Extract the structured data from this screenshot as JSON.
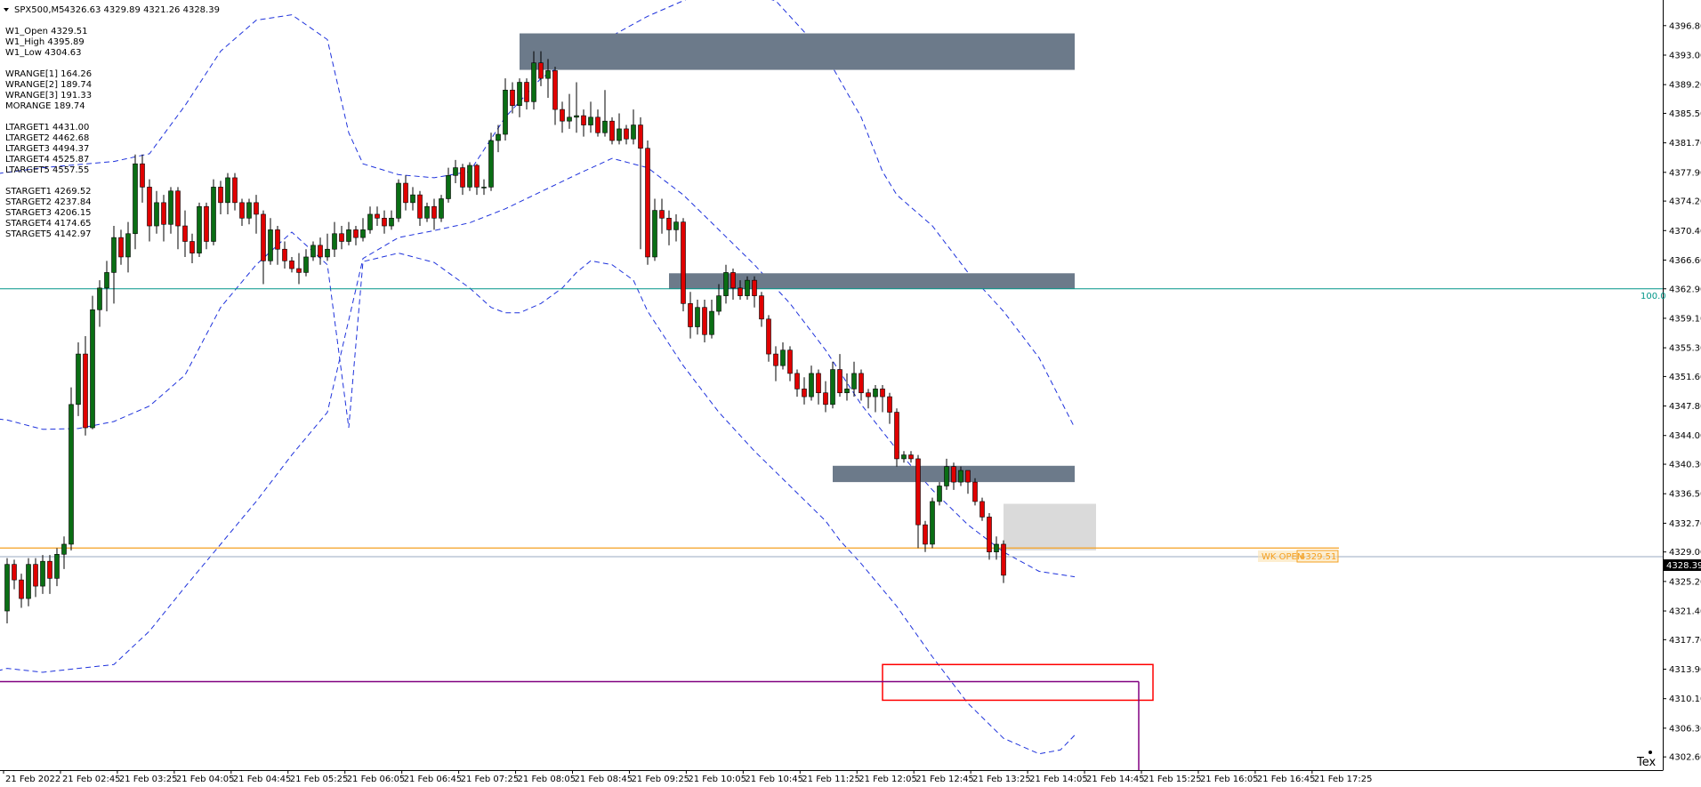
{
  "header": {
    "symbol_timeframe": "SPX500,M5",
    "ohlc": "4326.63 4329.89 4321.26 4328.39"
  },
  "info_panel": [
    "W1_Open 4329.51",
    "W1_High 4395.89",
    "W1_Low 4304.63",
    "",
    "WRANGE[1] 164.26",
    "WRANGE[2] 189.74",
    "WRANGE[3] 191.33",
    "MORANGE 189.74",
    "",
    "LTARGET1 4431.00",
    "LTARGET2 4462.68",
    "LTARGET3 4494.37",
    "LTARGET4 4525.87",
    "LTARGET5 4557.55",
    "",
    "STARGET1 4269.52",
    "STARGET2 4237.84",
    "STARGET3 4206.15",
    "STARGET4 4174.65",
    "STARGET5 4142.97"
  ],
  "colors": {
    "bull": "#0a6e14",
    "bear": "#e00000",
    "wick": "#000000",
    "band": "#1e32dc",
    "zone": "#6c7a8a",
    "teal_line": "#009688",
    "orange_line": "#f5a020",
    "purple_line": "#800080",
    "red_box": "#ff0000",
    "grey_box": "#d3d3d3"
  },
  "labels": {
    "fib_100": "100.0",
    "wk_open": "WK OPEN",
    "wk_open_price": "4329.51",
    "current_price": "4328.39",
    "corner": "Tex"
  },
  "chart_data": {
    "type": "candlestick",
    "symbol": "SPX500",
    "timeframe": "M5",
    "ylim": [
      4300.9,
      4400.1
    ],
    "grid": false,
    "price_ticks": [
      "4396.80",
      "4393.00",
      "4389.20",
      "4385.50",
      "4381.70",
      "4377.90",
      "4374.20",
      "4370.40",
      "4366.60",
      "4362.90",
      "4359.10",
      "4355.30",
      "4351.60",
      "4347.80",
      "4344.00",
      "4340.30",
      "4336.50",
      "4332.70",
      "4329.00",
      "4325.20",
      "4321.40",
      "4317.70",
      "4313.90",
      "4310.10",
      "4306.30",
      "4302.60"
    ],
    "time_labels": [
      "21 Feb 2022",
      "21 Feb 02:45",
      "21 Feb 03:25",
      "21 Feb 04:05",
      "21 Feb 04:45",
      "21 Feb 05:25",
      "21 Feb 06:05",
      "21 Feb 06:45",
      "21 Feb 07:25",
      "21 Feb 08:05",
      "21 Feb 08:45",
      "21 Feb 09:25",
      "21 Feb 10:05",
      "21 Feb 10:45",
      "21 Feb 11:25",
      "21 Feb 12:05",
      "21 Feb 12:45",
      "21 Feb 13:25",
      "21 Feb 14:05",
      "21 Feb 14:45",
      "21 Feb 15:25",
      "21 Feb 16:05",
      "21 Feb 16:45",
      "21 Feb 17:25"
    ],
    "horizontal_levels": {
      "fib_100": 4362.9,
      "weekly_open": 4329.51,
      "current": 4328.39,
      "purple": 4312.3
    },
    "supply_zones": [
      {
        "from_bar": 72,
        "to_bar": 150,
        "top": 4395.8,
        "bottom": 4391.1
      },
      {
        "from_bar": 93,
        "to_bar": 150,
        "top": 4364.9,
        "bottom": 4362.9
      },
      {
        "from_bar": 116,
        "to_bar": 150,
        "top": 4340.1,
        "bottom": 4338.0
      }
    ],
    "demand_box": {
      "from_bar": 123,
      "to_bar": 161,
      "top": 4314.5,
      "bottom": 4309.9
    },
    "range_box": {
      "from_bar": 140,
      "to_bar": 153,
      "top": 4335.2,
      "bottom": 4329.2
    },
    "upper_band": [
      [
        -5,
        4377.3
      ],
      [
        5,
        4378.5
      ],
      [
        15,
        4379.3
      ],
      [
        20,
        4380.3
      ],
      [
        25,
        4386.5
      ],
      [
        30,
        4393.5
      ],
      [
        35,
        4397.5
      ],
      [
        40,
        4398.2
      ],
      [
        45,
        4395
      ],
      [
        48,
        4383
      ],
      [
        50,
        4379
      ],
      [
        55,
        4377.6
      ],
      [
        60,
        4377.2
      ],
      [
        65,
        4378
      ],
      [
        70,
        4385
      ],
      [
        75,
        4390
      ],
      [
        80,
        4393
      ],
      [
        85,
        4395.5
      ],
      [
        90,
        4398
      ],
      [
        100,
        4402
      ],
      [
        108,
        4400
      ],
      [
        115,
        4393
      ],
      [
        120,
        4385
      ],
      [
        123,
        4378
      ],
      [
        125,
        4375
      ],
      [
        130,
        4371
      ],
      [
        135,
        4365
      ],
      [
        140,
        4360
      ],
      [
        145,
        4354
      ],
      [
        150,
        4345
      ]
    ],
    "middle_band": [
      [
        -5,
        4312.8
      ],
      [
        0,
        4314
      ],
      [
        5,
        4313.5
      ],
      [
        10,
        4314
      ],
      [
        15,
        4314.5
      ],
      [
        20,
        4318.8
      ],
      [
        25,
        4324.5
      ],
      [
        30,
        4330
      ],
      [
        35,
        4335.5
      ],
      [
        40,
        4341.5
      ],
      [
        45,
        4347
      ],
      [
        50,
        4366.8
      ],
      [
        55,
        4369.5
      ],
      [
        60,
        4370.4
      ],
      [
        65,
        4371.4
      ],
      [
        70,
        4373.2
      ],
      [
        75,
        4375.4
      ],
      [
        80,
        4377.6
      ],
      [
        85,
        4379.7
      ],
      [
        90,
        4378.5
      ],
      [
        95,
        4375
      ],
      [
        100,
        4370.5
      ],
      [
        105,
        4366
      ],
      [
        110,
        4361
      ],
      [
        115,
        4355
      ],
      [
        120,
        4348
      ],
      [
        125,
        4342.2
      ],
      [
        130,
        4337
      ],
      [
        135,
        4332.5
      ],
      [
        140,
        4329
      ],
      [
        145,
        4326.5
      ],
      [
        150,
        4325.8
      ]
    ],
    "lower_band": [
      [
        -5,
        4346.5
      ],
      [
        0,
        4346
      ],
      [
        5,
        4344.8
      ],
      [
        10,
        4344.9
      ],
      [
        15,
        4345.8
      ],
      [
        20,
        4347.8
      ],
      [
        25,
        4351.8
      ],
      [
        30,
        4360.5
      ],
      [
        35,
        4366
      ],
      [
        40,
        4370.2
      ],
      [
        45,
        4366
      ],
      [
        48,
        4345
      ],
      [
        50,
        4366.4
      ],
      [
        55,
        4367.5
      ],
      [
        60,
        4366.3
      ],
      [
        65,
        4363
      ],
      [
        68,
        4360.5
      ],
      [
        70,
        4359.8
      ],
      [
        72,
        4359.8
      ],
      [
        75,
        4361
      ],
      [
        78,
        4363
      ],
      [
        80,
        4365
      ],
      [
        82,
        4366.5
      ],
      [
        85,
        4366
      ],
      [
        88,
        4364
      ],
      [
        90,
        4360
      ],
      [
        95,
        4353
      ],
      [
        100,
        4347
      ],
      [
        105,
        4342
      ],
      [
        110,
        4337.5
      ],
      [
        115,
        4333
      ],
      [
        117,
        4330.5
      ],
      [
        120,
        4327.5
      ],
      [
        125,
        4322
      ],
      [
        130,
        4315.5
      ],
      [
        135,
        4309.5
      ],
      [
        140,
        4305
      ],
      [
        145,
        4303
      ],
      [
        148,
        4303.5
      ],
      [
        150,
        4305.4
      ]
    ],
    "candles": [
      [
        4321.4,
        4327.4,
        4319.8,
        4328.2
      ],
      [
        4327.4,
        4325.4,
        4324.2,
        4328.0
      ],
      [
        4325.4,
        4323.0,
        4321.8,
        4326.2
      ],
      [
        4323.0,
        4327.4,
        4322.0,
        4328.2
      ],
      [
        4327.4,
        4324.6,
        4323.2,
        4328.2
      ],
      [
        4324.6,
        4327.8,
        4323.6,
        4328.6
      ],
      [
        4327.8,
        4325.6,
        4323.6,
        4328.6
      ],
      [
        4325.6,
        4328.7,
        4324.6,
        4329.5
      ],
      [
        4328.7,
        4330.0,
        4326.8,
        4331.0
      ],
      [
        4330.0,
        4348.0,
        4329.2,
        4350.2
      ],
      [
        4348.0,
        4354.5,
        4346.5,
        4356.0
      ],
      [
        4354.5,
        4345.0,
        4344.0,
        4356.8
      ],
      [
        4345.0,
        4360.2,
        4344.8,
        4362.0
      ],
      [
        4360.2,
        4363.0,
        4358.0,
        4364.0
      ],
      [
        4363.0,
        4365.0,
        4360.0,
        4366.5
      ],
      [
        4365.0,
        4369.5,
        4361.0,
        4371.0
      ],
      [
        4369.5,
        4367.0,
        4366.0,
        4370.5
      ],
      [
        4367.0,
        4370.0,
        4365.0,
        4371.5
      ],
      [
        4370.0,
        4379.0,
        4368.0,
        4380.2
      ],
      [
        4379.0,
        4376.0,
        4374.0,
        4380.2
      ],
      [
        4376.0,
        4371.0,
        4369.0,
        4377.0
      ],
      [
        4371.0,
        4374.0,
        4370.0,
        4375.5
      ],
      [
        4374.0,
        4371.2,
        4369.0,
        4375.0
      ],
      [
        4371.2,
        4375.5,
        4370.0,
        4376.0
      ],
      [
        4375.5,
        4371.0,
        4368.0,
        4376.0
      ],
      [
        4371.0,
        4369.0,
        4367.0,
        4373.0
      ],
      [
        4369.0,
        4367.5,
        4366.2,
        4370.0
      ],
      [
        4367.5,
        4373.5,
        4367.0,
        4374.0
      ],
      [
        4373.5,
        4369.0,
        4368.0,
        4374.0
      ],
      [
        4369.0,
        4376.0,
        4368.5,
        4377.0
      ],
      [
        4376.0,
        4374.0,
        4372.5,
        4376.8
      ],
      [
        4374.0,
        4377.2,
        4372.5,
        4377.8
      ],
      [
        4377.2,
        4374.0,
        4373.0,
        4377.8
      ],
      [
        4374.0,
        4372.0,
        4371.0,
        4374.5
      ],
      [
        4372.0,
        4374.0,
        4371.2,
        4374.5
      ],
      [
        4374.0,
        4372.5,
        4370.0,
        4375.0
      ],
      [
        4372.5,
        4366.5,
        4363.5,
        4373.0
      ],
      [
        4366.5,
        4370.5,
        4366.0,
        4372.0
      ],
      [
        4370.5,
        4368.0,
        4366.0,
        4371.0
      ],
      [
        4368.0,
        4366.5,
        4365.5,
        4369.0
      ],
      [
        4366.5,
        4365.5,
        4365.0,
        4367.0
      ],
      [
        4365.5,
        4365.0,
        4363.5,
        4367.5
      ],
      [
        4365.0,
        4367.0,
        4364.5,
        4368.0
      ],
      [
        4367.0,
        4368.5,
        4366.5,
        4369.0
      ],
      [
        4368.5,
        4367.0,
        4366.0,
        4369.5
      ],
      [
        4367.0,
        4368.0,
        4366.5,
        4370.0
      ],
      [
        4368.0,
        4370.0,
        4367.0,
        4371.5
      ],
      [
        4370.0,
        4369.0,
        4368.0,
        4371.0
      ],
      [
        4369.0,
        4370.5,
        4368.5,
        4371.5
      ],
      [
        4370.5,
        4369.5,
        4368.5,
        4371.0
      ],
      [
        4369.5,
        4370.5,
        4369.0,
        4372.0
      ],
      [
        4370.5,
        4372.5,
        4370.0,
        4373.5
      ],
      [
        4372.5,
        4372.0,
        4371.0,
        4373.5
      ],
      [
        4372.0,
        4371.0,
        4370.0,
        4373.0
      ],
      [
        4371.0,
        4372.0,
        4370.5,
        4373.0
      ],
      [
        4372.0,
        4376.5,
        4371.5,
        4377.0
      ],
      [
        4376.5,
        4374.0,
        4373.0,
        4377.5
      ],
      [
        4374.0,
        4375.0,
        4373.0,
        4376.0
      ],
      [
        4375.0,
        4372.0,
        4371.0,
        4375.5
      ],
      [
        4372.0,
        4373.5,
        4371.5,
        4374.0
      ],
      [
        4373.5,
        4372.0,
        4370.5,
        4374.5
      ],
      [
        4372.0,
        4374.5,
        4371.5,
        4375.0
      ],
      [
        4374.5,
        4377.5,
        4374.0,
        4378.5
      ],
      [
        4377.5,
        4378.5,
        4376.5,
        4379.5
      ],
      [
        4378.5,
        4376.0,
        4375.0,
        4379.0
      ],
      [
        4376.0,
        4378.8,
        4375.5,
        4379.2
      ],
      [
        4378.8,
        4376.0,
        4375.0,
        4379.0
      ],
      [
        4376.0,
        4376.0,
        4375.0,
        4377.0
      ],
      [
        4376.0,
        4382.0,
        4375.5,
        4383.0
      ],
      [
        4382.0,
        4382.8,
        4380.5,
        4384.0
      ],
      [
        4382.8,
        4388.5,
        4382.0,
        4390.0
      ],
      [
        4388.5,
        4386.5,
        4385.5,
        4389.5
      ],
      [
        4386.5,
        4389.5,
        4385.0,
        4390.0
      ],
      [
        4389.5,
        4387.0,
        4386.0,
        4390.0
      ],
      [
        4387.0,
        4392.0,
        4386.0,
        4393.5
      ],
      [
        4392.0,
        4390.0,
        4389.0,
        4393.5
      ],
      [
        4390.0,
        4391.0,
        4387.5,
        4392.5
      ],
      [
        4391.0,
        4386.0,
        4384.0,
        4391.5
      ],
      [
        4386.0,
        4384.5,
        4383.0,
        4387.0
      ],
      [
        4384.5,
        4385.0,
        4383.5,
        4388.0
      ],
      [
        4385.0,
        4385.2,
        4383.0,
        4389.5
      ],
      [
        4385.2,
        4384.0,
        4382.5,
        4386.0
      ],
      [
        4384.0,
        4385.0,
        4383.0,
        4387.0
      ],
      [
        4385.0,
        4383.0,
        4382.5,
        4386.0
      ],
      [
        4383.0,
        4384.5,
        4382.5,
        4388.5
      ],
      [
        4384.5,
        4382.0,
        4381.5,
        4385.0
      ],
      [
        4382.0,
        4383.5,
        4381.5,
        4385.5
      ],
      [
        4383.5,
        4382.2,
        4381.5,
        4384.0
      ],
      [
        4382.2,
        4384.0,
        4381.5,
        4386.0
      ],
      [
        4384.0,
        4381.0,
        4368.0,
        4385.0
      ],
      [
        4381.0,
        4367.0,
        4366.0,
        4382.0
      ],
      [
        4367.0,
        4373.0,
        4366.5,
        4374.5
      ],
      [
        4373.0,
        4372.0,
        4370.0,
        4374.5
      ],
      [
        4372.0,
        4370.5,
        4368.5,
        4373.0
      ],
      [
        4370.5,
        4371.5,
        4369.0,
        4372.5
      ],
      [
        4371.5,
        4361.0,
        4360.0,
        4372.0
      ],
      [
        4361.0,
        4358.0,
        4356.5,
        4362.5
      ],
      [
        4358.0,
        4360.5,
        4357.0,
        4361.5
      ],
      [
        4360.5,
        4357.0,
        4356.0,
        4361.5
      ],
      [
        4357.0,
        4360.0,
        4356.5,
        4361.5
      ],
      [
        4360.0,
        4362.0,
        4359.5,
        4363.5
      ],
      [
        4362.0,
        4365.0,
        4361.0,
        4366.0
      ],
      [
        4365.0,
        4363.0,
        4361.5,
        4365.5
      ],
      [
        4363.0,
        4362.0,
        4361.5,
        4364.0
      ],
      [
        4362.0,
        4364.0,
        4361.5,
        4364.5
      ],
      [
        4364.0,
        4362.0,
        4360.5,
        4364.5
      ],
      [
        4362.0,
        4359.0,
        4358.0,
        4362.5
      ],
      [
        4359.0,
        4354.5,
        4353.5,
        4359.5
      ],
      [
        4354.5,
        4353.0,
        4351.0,
        4355.5
      ],
      [
        4353.0,
        4355.0,
        4352.5,
        4356.0
      ],
      [
        4355.0,
        4352.0,
        4351.0,
        4355.5
      ],
      [
        4352.0,
        4350.0,
        4349.0,
        4352.5
      ],
      [
        4350.0,
        4349.0,
        4348.0,
        4351.5
      ],
      [
        4349.0,
        4352.0,
        4348.5,
        4353.0
      ],
      [
        4352.0,
        4349.5,
        4348.0,
        4352.5
      ],
      [
        4349.5,
        4348.0,
        4347.0,
        4351.0
      ],
      [
        4348.0,
        4352.5,
        4347.5,
        4353.5
      ],
      [
        4352.5,
        4349.5,
        4349.0,
        4354.5
      ],
      [
        4349.5,
        4350.0,
        4348.5,
        4352.0
      ],
      [
        4350.0,
        4352.0,
        4349.0,
        4353.5
      ],
      [
        4352.0,
        4349.5,
        4348.5,
        4352.5
      ],
      [
        4349.5,
        4349.0,
        4347.5,
        4350.0
      ],
      [
        4349.0,
        4350.0,
        4347.0,
        4350.5
      ],
      [
        4350.0,
        4349.0,
        4347.0,
        4350.5
      ],
      [
        4349.0,
        4347.0,
        4345.5,
        4349.5
      ],
      [
        4347.0,
        4341.0,
        4340.0,
        4347.5
      ],
      [
        4341.0,
        4341.5,
        4340.5,
        4342.0
      ],
      [
        4341.5,
        4341.0,
        4340.5,
        4342.0
      ],
      [
        4341.0,
        4332.5,
        4329.5,
        4341.5
      ],
      [
        4332.5,
        4330.0,
        4329.0,
        4333.0
      ],
      [
        4330.0,
        4335.5,
        4329.5,
        4336.0
      ],
      [
        4335.5,
        4337.5,
        4335.0,
        4338.0
      ],
      [
        4337.5,
        4340.0,
        4337.0,
        4341.0
      ],
      [
        4340.0,
        4338.0,
        4337.0,
        4340.5
      ],
      [
        4338.0,
        4339.5,
        4337.5,
        4340.0
      ],
      [
        4339.5,
        4338.0,
        4336.5,
        4339.5
      ],
      [
        4338.0,
        4335.5,
        4335.0,
        4338.5
      ],
      [
        4335.5,
        4333.5,
        4333.0,
        4336.0
      ],
      [
        4333.5,
        4329.0,
        4328.0,
        4334.0
      ],
      [
        4329.0,
        4330.0,
        4328.0,
        4331.0
      ],
      [
        4330.0,
        4326.0,
        4325.0,
        4330.5
      ]
    ]
  }
}
